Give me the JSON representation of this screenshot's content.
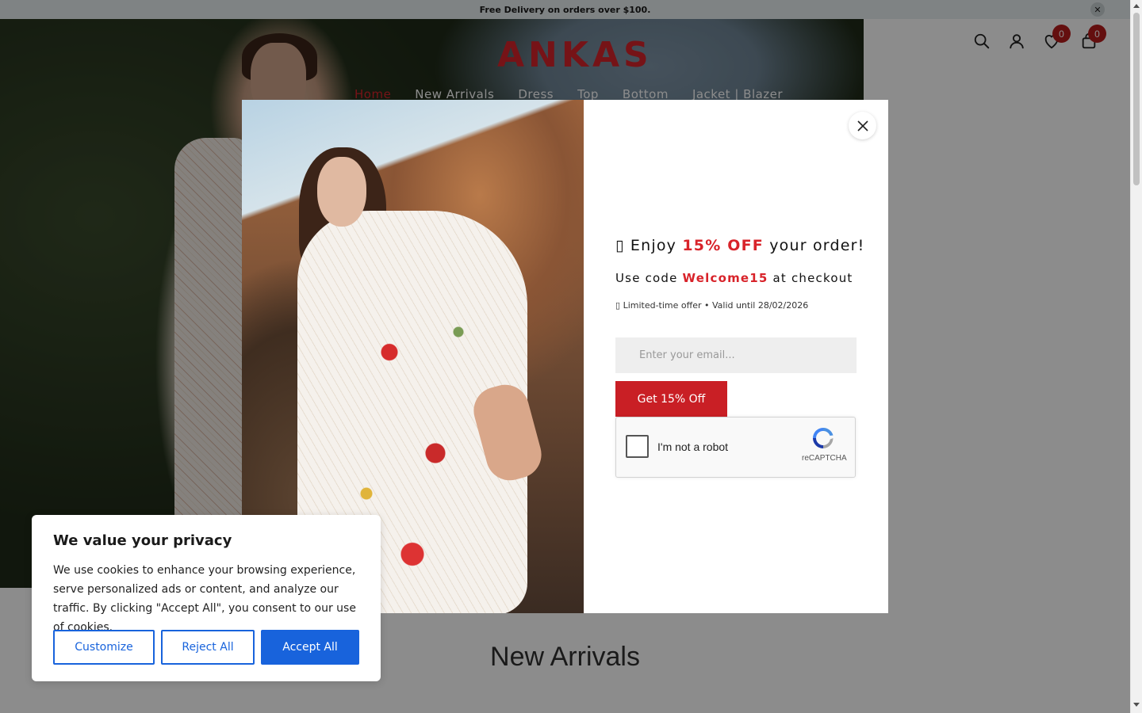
{
  "announcement": {
    "text": "Free Delivery on orders over $100.",
    "close": "✕"
  },
  "header": {
    "logo": "ANKAS",
    "nav": [
      {
        "label": "Home",
        "active": true
      },
      {
        "label": "New Arrivals"
      },
      {
        "label": "Dress"
      },
      {
        "label": "Top"
      },
      {
        "label": "Bottom"
      },
      {
        "label": "Jacket | Blazer"
      }
    ],
    "wishlist_count": "0",
    "cart_count": "0",
    "icons": [
      "search-icon",
      "account-icon",
      "wishlist-heart-icon",
      "cart-bag-icon"
    ]
  },
  "section": {
    "title": "New Arrivals"
  },
  "popup": {
    "headline_prefix": "Enjoy",
    "headline_highlight": "15% OFF",
    "headline_suffix": "your order!",
    "code_prefix": "Use code",
    "code": "Welcome15",
    "code_suffix": "at checkout",
    "validity": "Limited-time offer • Valid until 28/02/2026",
    "email_placeholder": "Enter your email...",
    "submit_label": "Get 15% Off",
    "recaptcha_label": "I'm not a robot",
    "recaptcha_brand": "reCAPTCHA"
  },
  "cookie": {
    "title": "We value your privacy",
    "text": "We use cookies to enhance your browsing experience, serve personalized ads or content, and analyze our traffic. By clicking \"Accept All\", you consent to our use of cookies.",
    "customize": "Customize",
    "reject": "Reject All",
    "accept": "Accept All"
  },
  "colors": {
    "brand_red": "#d8232a",
    "accept_blue": "#1863dc",
    "badge_red": "#b71c1c"
  }
}
